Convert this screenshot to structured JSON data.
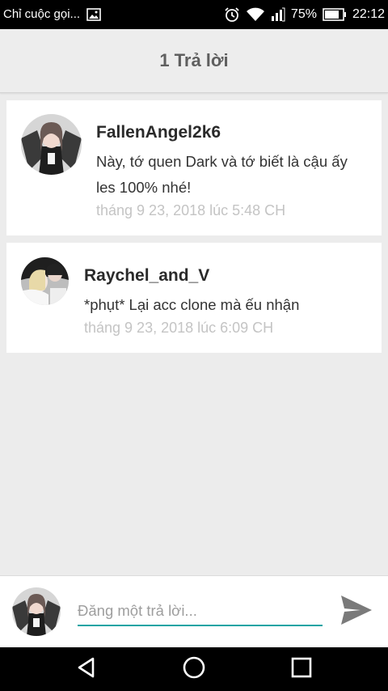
{
  "status_bar": {
    "notification_text": "Chỉ cuộc gọi...",
    "battery": "75%",
    "time": "22:12"
  },
  "header": {
    "title": "1 Trả lời"
  },
  "replies": [
    {
      "author": "FallenAngel2k6",
      "lines": [
        "Này, tớ quen Dark và tớ biết là cậu ấy",
        "les 100% nhé!"
      ],
      "timestamp": "tháng 9 23, 2018 lúc 5:48 CH"
    },
    {
      "author": "Raychel_and_V",
      "lines": [
        "*phụt* Lại acc clone mà ếu nhận"
      ],
      "timestamp": "tháng 9 23, 2018 lúc 6:09 CH"
    }
  ],
  "composer": {
    "placeholder": "Đăng một trả lời..."
  },
  "colors": {
    "accent": "#1aa4a4",
    "background": "#ececec",
    "timestamp": "#c4c4c4"
  },
  "icons": {
    "status": [
      "image-icon",
      "alarm-icon",
      "wifi-icon",
      "signal-icon",
      "battery-icon"
    ],
    "composer": "send-icon",
    "navigation": [
      "back-icon",
      "home-icon",
      "recents-icon"
    ]
  }
}
